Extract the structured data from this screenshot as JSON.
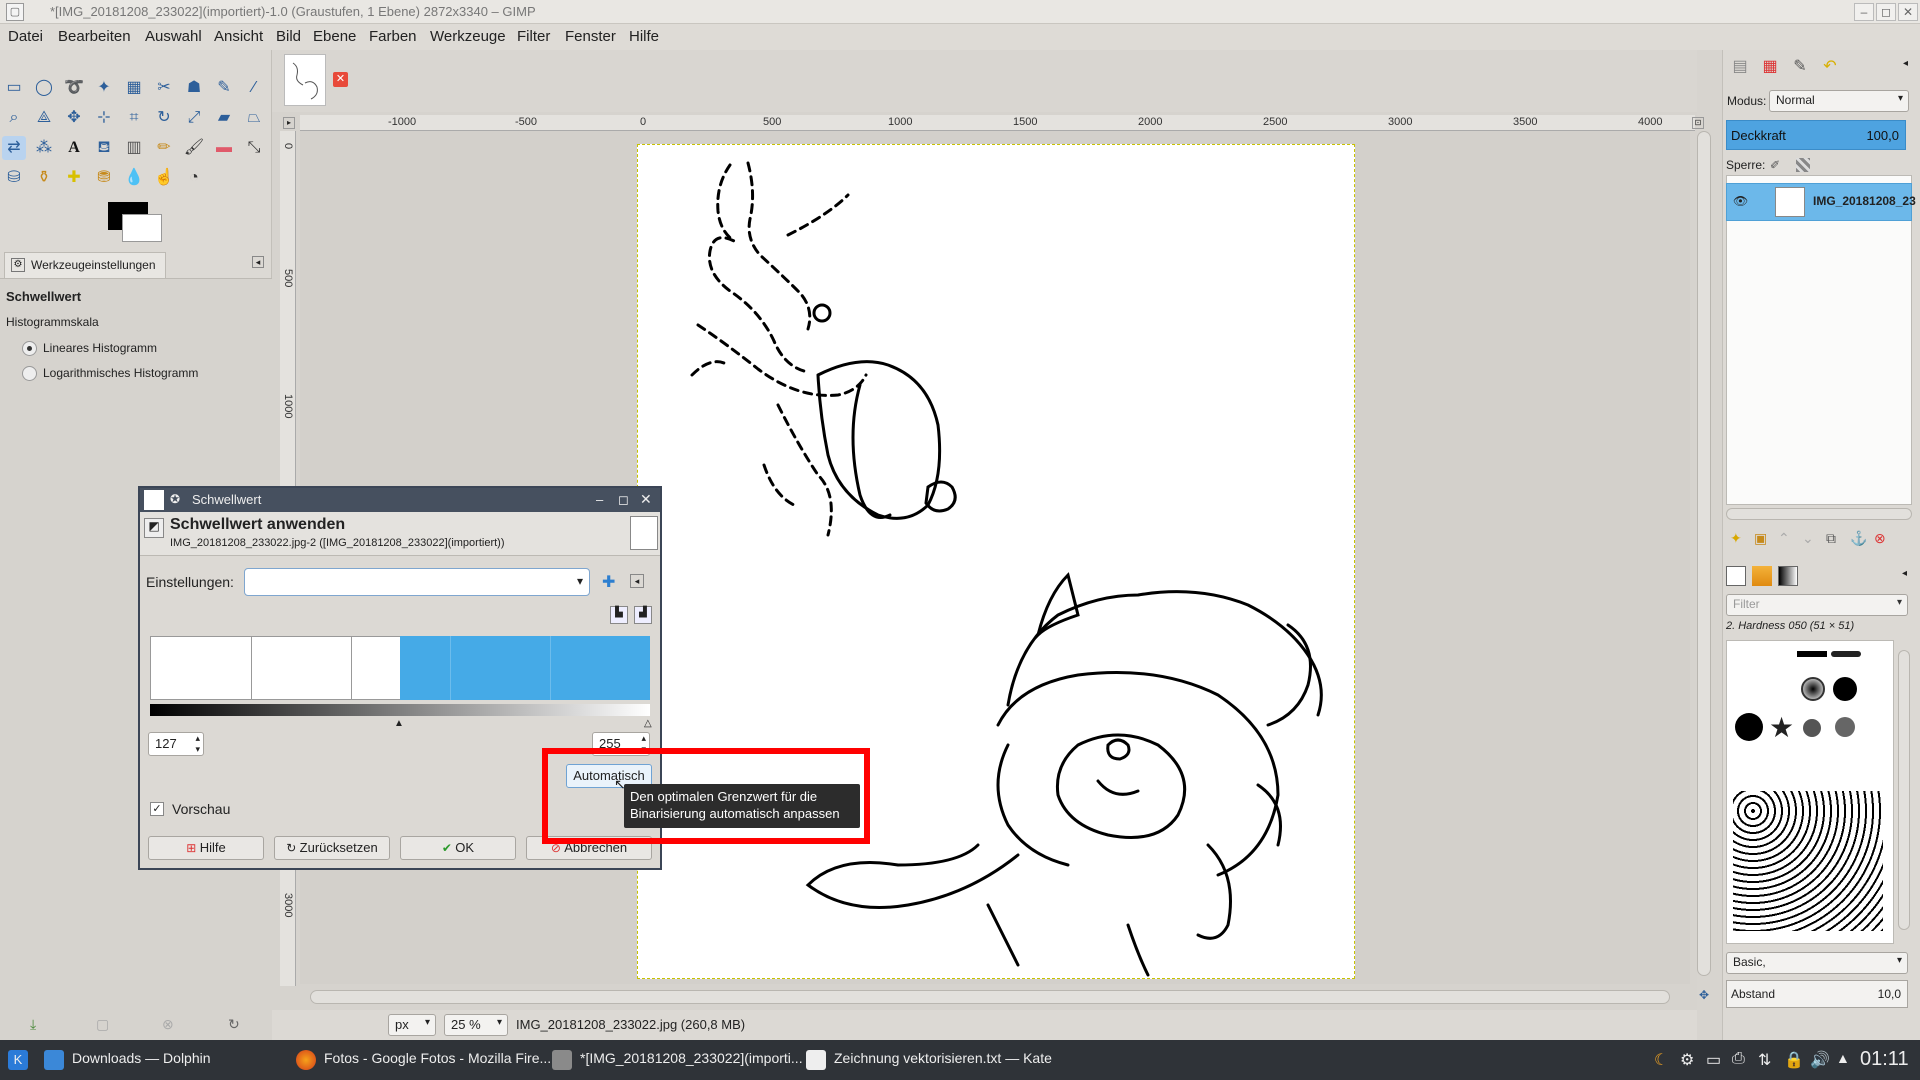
{
  "window": {
    "title": "*[IMG_20181208_233022](importiert)-1.0 (Graustufen, 1 Ebene) 2872x3340 – GIMP",
    "min": "–",
    "max": "◻",
    "close": "✕"
  },
  "menu": [
    "Datei",
    "Bearbeiten",
    "Auswahl",
    "Ansicht",
    "Bild",
    "Ebene",
    "Farben",
    "Werkzeuge",
    "Filter",
    "Fenster",
    "Hilfe"
  ],
  "toolbox": {
    "tab_label": "Werkzeugeinstellungen",
    "tool_name": "Schwellwert",
    "histogram_scale_label": "Histogrammskala",
    "radio_linear": "Lineares Histogramm",
    "radio_log": "Logarithmisches Histogramm"
  },
  "rulers": {
    "h_ticks": [
      "-1000",
      "-500",
      "0",
      "500",
      "1000",
      "1500",
      "2000",
      "2500",
      "3000",
      "3500",
      "4000"
    ],
    "v_ticks": [
      "0",
      "500",
      "1000",
      "3000"
    ]
  },
  "status": {
    "unit": "px",
    "zoom": "25 %",
    "file": "IMG_20181208_233022.jpg (260,8 MB)"
  },
  "dock": {
    "mode_label": "Modus:",
    "mode_value": "Normal",
    "opacity_label": "Deckkraft",
    "opacity_value": "100,0",
    "lock_label": "Sperre:",
    "layer_name": "IMG_20181208_23",
    "filter_placeholder": "Filter",
    "brush_name": "2. Hardness 050 (51 × 51)",
    "brush_tag": "Basic,",
    "spacing_label": "Abstand",
    "spacing_value": "10,0"
  },
  "dialog": {
    "title": "Schwellwert",
    "header": "Schwellwert anwenden",
    "subheader": "IMG_20181208_233022.jpg-2 ([IMG_20181208_233022](importiert))",
    "settings_label": "Einstellungen:",
    "low_value": "127",
    "high_value": "255",
    "auto_button": "Automatisch",
    "preview_label": "Vorschau",
    "help_button": "Hilfe",
    "reset_button": "Zurücksetzen",
    "ok_button": "OK",
    "cancel_button": "Abbrechen",
    "tooltip_line1": "Den optimalen Grenzwert für die",
    "tooltip_line2": "Binarisierung automatisch anpassen",
    "threshold_low": 127,
    "threshold_high": 255
  },
  "taskbar": {
    "task1": "Downloads — Dolphin",
    "task2": "Fotos - Google Fotos - Mozilla Fire...",
    "task3": "*[IMG_20181208_233022](importi...",
    "task4": "Zeichnung vektorisieren.txt — Kate",
    "clock": "01:11"
  },
  "colors": {
    "accent": "#45aae7",
    "highlight": "#ff0000",
    "taskbar": "#2f3338"
  }
}
